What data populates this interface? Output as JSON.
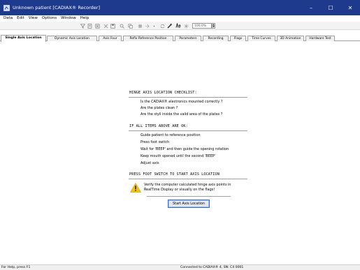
{
  "window": {
    "title": "Unknown patient [CADIAX® Recorder]",
    "controls": {
      "minimize": "–",
      "maximize": "☐",
      "close": "✕"
    },
    "titlebar_color": "#1e3a8c"
  },
  "menu": [
    "Data",
    "Edit",
    "View",
    "Options",
    "Window",
    "Help"
  ],
  "toolbar": {
    "zoom_value": "100.0%",
    "icons": [
      "funnel-icon",
      "print-preview-icon",
      "clear-icon",
      "close-x-icon",
      "save-icon",
      "search-icon",
      "copy-icon",
      "grid-icon",
      "filter-icon",
      "magic-icon",
      "sync-icon",
      "settings-icon",
      "radial-icon"
    ]
  },
  "tabs": [
    {
      "label": "Single Axis Location",
      "active": true
    },
    {
      "label": "Dynamic Axis Location",
      "active": false
    },
    {
      "label": "Axis Four",
      "active": false
    },
    {
      "label": "Refix Reference Position",
      "active": false
    },
    {
      "label": "Parameters",
      "active": false
    },
    {
      "label": "Recording",
      "active": false
    },
    {
      "label": "Flags",
      "active": false
    },
    {
      "label": "Time Curves",
      "active": false
    },
    {
      "label": "3D Animation",
      "active": false
    },
    {
      "label": "Hardware Test",
      "active": false
    }
  ],
  "checklist": {
    "heading": "HINGE AXIS LOCATION CHECKLIST:",
    "items": [
      "Is the CADIAX® electronics mounted correctly ?",
      "Are the plates clean ?",
      "Are the styli inside the valid area of the plates ?"
    ]
  },
  "ok_section": {
    "heading": "IF ALL ITEMS ABOVE ARE OK:",
    "items": [
      "Guide patient to reference position",
      "Press foot switch",
      "Wait for 'BEEP' and then guide the opening rotation",
      "Keep mouth opened  until the second 'BEEP'",
      "Adjust axis"
    ]
  },
  "start_section": {
    "heading": "PRESS FOOT SWITCH TO START AXIS LOCATION",
    "warning_line1": "Verify the computer calculated hinge axis points in",
    "warning_line2": "RealTime Display or visually on the flags!",
    "button_label": "Start Axis Location"
  },
  "statusbar": {
    "left": "For Help, press F1",
    "right": "Connected to CADIAX® 4, SN: C4 0001"
  },
  "colors": {
    "warning_yellow": "#f5c400",
    "button_border": "#3a6fd0"
  }
}
